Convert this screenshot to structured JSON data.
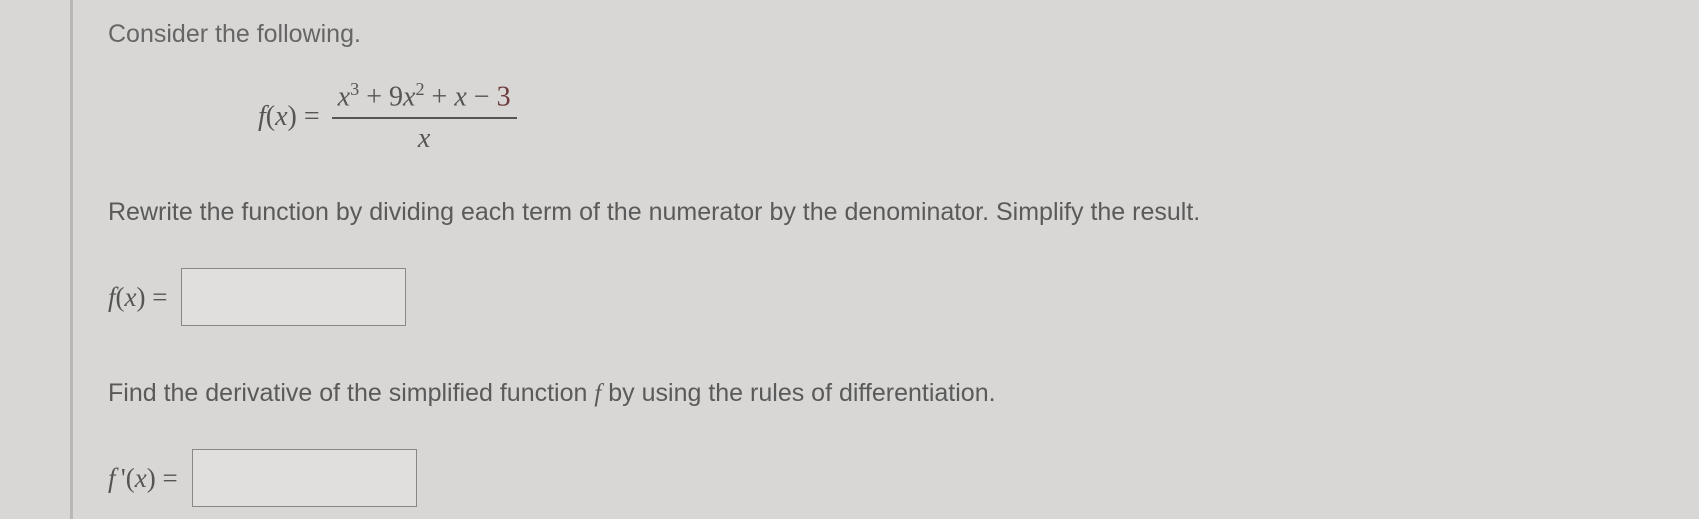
{
  "prompt": "Consider the following.",
  "equation": {
    "lhs": "f(x) =",
    "numerator_html": "x^3 + 9x^2 + x − 3",
    "denominator": "x"
  },
  "instruction1": "Rewrite the function by dividing each term of the numerator by the denominator. Simplify the result.",
  "answer1": {
    "label": "f(x)",
    "eq": "=",
    "value": ""
  },
  "instruction2": "Find the derivative of the simplified function f by using the rules of differentiation.",
  "answer2": {
    "label": "f '(x)",
    "eq": "=",
    "value": ""
  },
  "chart_data": {
    "type": "table",
    "note": "This is a math problem document; numeric expressions are the data.",
    "numerator_terms": [
      "x^3",
      "9x^2",
      "x",
      "-3"
    ],
    "denominator": "x"
  }
}
